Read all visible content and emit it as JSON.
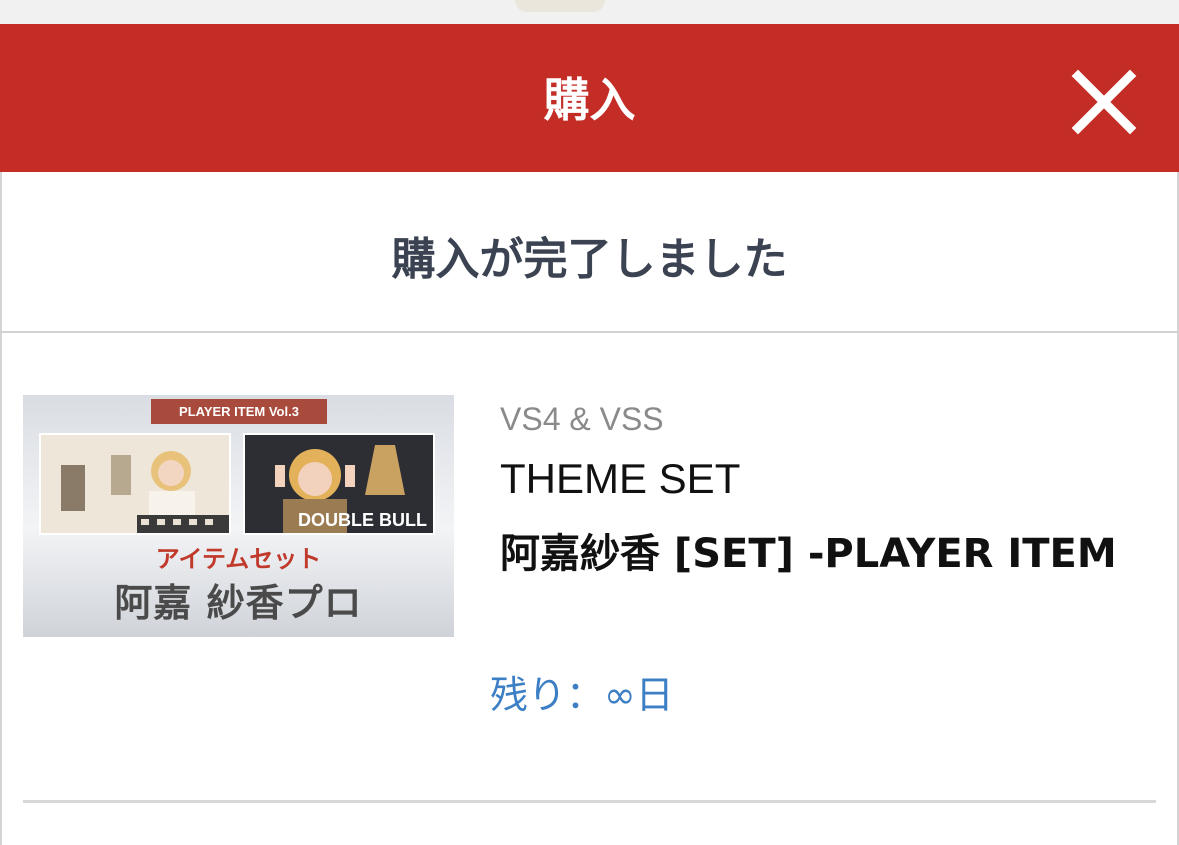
{
  "dialog": {
    "title": "購入",
    "close_icon": "close-icon",
    "status_message": "購入が完了しました"
  },
  "item": {
    "thumbnail": {
      "banner": "PLAYER ITEM Vol.3",
      "photo_tag": "DOUBLE BULL",
      "subtitle": "アイテムセット",
      "name": "阿嘉 紗香プロ"
    },
    "platform": "VS4 & VSS",
    "category": "THEME SET",
    "name": "阿嘉紗香 [SET] -PLAYER ITEM",
    "remaining": "残り：∞日"
  },
  "colors": {
    "header": "#c42d26",
    "status_text": "#3b4252",
    "remaining_text": "#3d7fc4"
  }
}
